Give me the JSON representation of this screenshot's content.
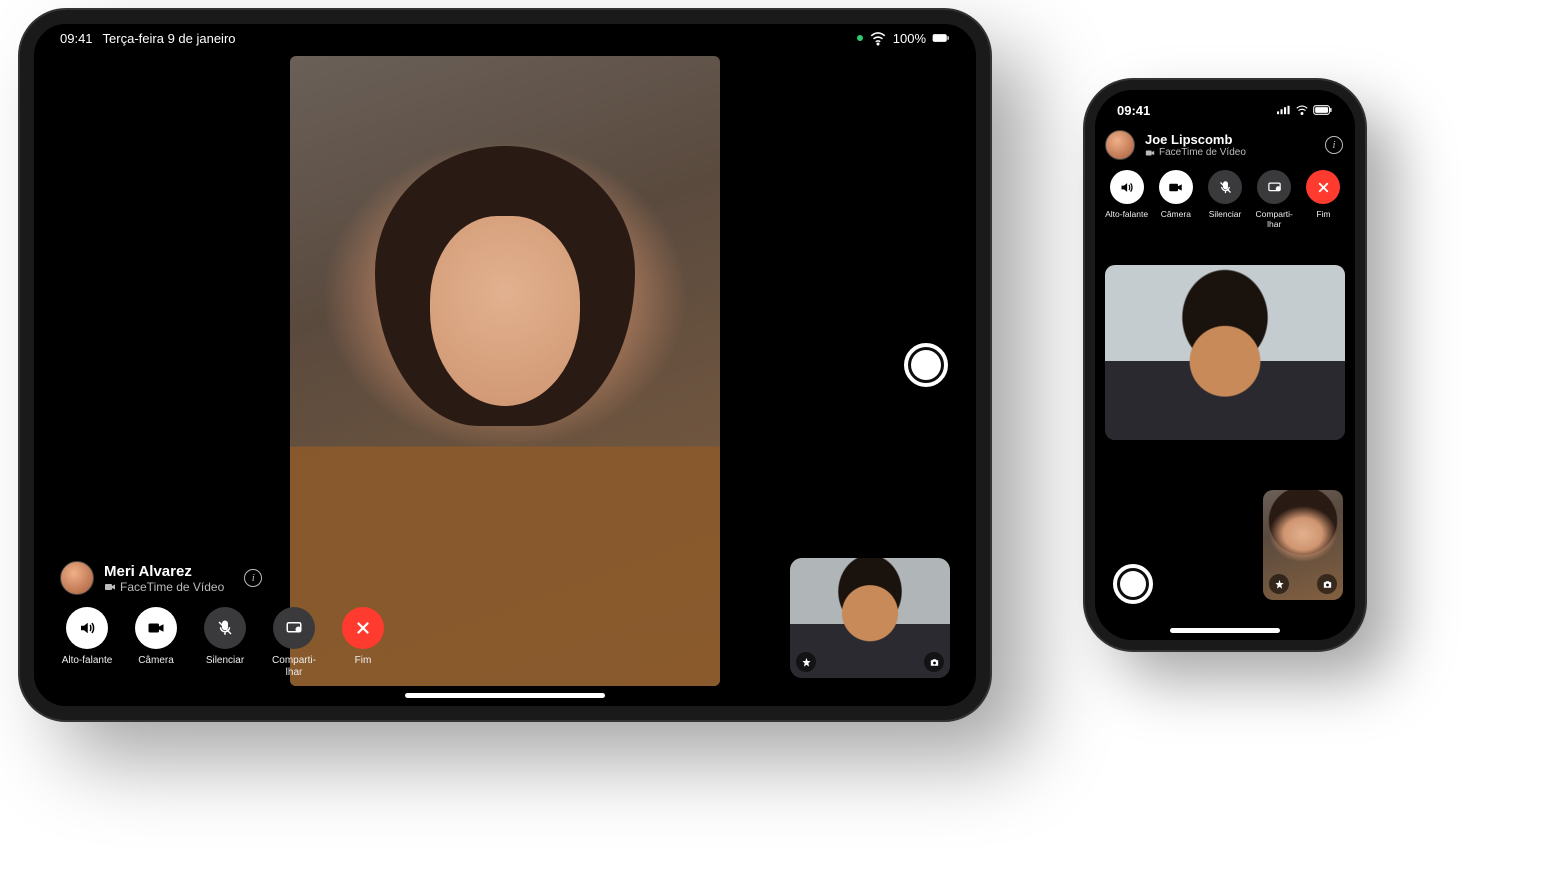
{
  "ipad": {
    "statusbar": {
      "time": "09:41",
      "date": "Terça-feira 9 de janeiro",
      "battery_pct": "100%"
    },
    "caller": {
      "name": "Meri Alvarez",
      "subtitle": "FaceTime de Vídeo"
    },
    "controls": {
      "speaker": "Alto-falante",
      "camera": "Câmera",
      "mute": "Silenciar",
      "share": "Comparti-\nlhar",
      "end": "Fim"
    }
  },
  "iphone": {
    "statusbar": {
      "time": "09:41"
    },
    "caller": {
      "name": "Joe Lipscomb",
      "subtitle": "FaceTime de Vídeo"
    },
    "controls": {
      "speaker": "Alto-falante",
      "camera": "Câmera",
      "mute": "Silenciar",
      "share": "Comparti-\nlhar",
      "end": "Fim"
    }
  },
  "colors": {
    "end_call": "#ff3b30"
  }
}
